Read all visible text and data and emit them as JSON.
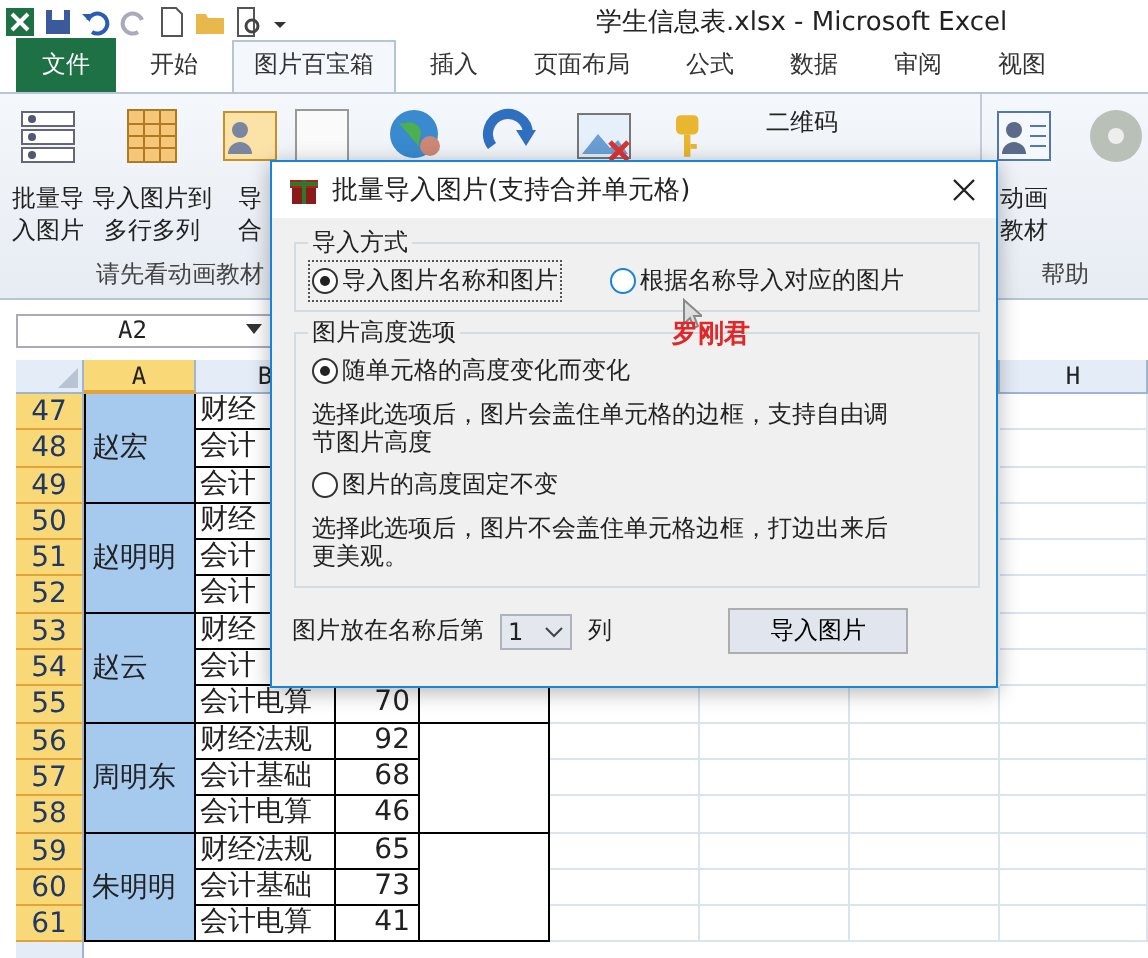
{
  "window": {
    "title": "学生信息表.xlsx  -  Microsoft Excel"
  },
  "ribbon_tabs": [
    {
      "label": "文件",
      "kind": "file",
      "selected": false
    },
    {
      "label": "开始",
      "kind": "tab",
      "selected": false
    },
    {
      "label": "图片百宝箱",
      "kind": "tab",
      "selected": true
    },
    {
      "label": "插入",
      "kind": "tab",
      "selected": false
    },
    {
      "label": "页面布局",
      "kind": "tab",
      "selected": false
    },
    {
      "label": "公式",
      "kind": "tab",
      "selected": false
    },
    {
      "label": "数据",
      "kind": "tab",
      "selected": false
    },
    {
      "label": "审阅",
      "kind": "tab",
      "selected": false
    },
    {
      "label": "视图",
      "kind": "tab",
      "selected": false
    }
  ],
  "ribbon": {
    "buttons": [
      {
        "kind": "list",
        "lines": [
          "批量导",
          "入图片"
        ]
      },
      {
        "kind": "grid",
        "lines": [
          "导入图片到",
          "多行多列"
        ]
      },
      {
        "kind": "card",
        "lines": [
          "导",
          "合"
        ]
      }
    ],
    "group_label": "请先看动画教材",
    "qr_label": "二维码",
    "help_buttons": [
      {
        "lines": [
          "动画",
          "教材"
        ]
      }
    ],
    "help_label": "帮助"
  },
  "name_box": {
    "value": "A2"
  },
  "sheet": {
    "columns": [
      {
        "label": "A",
        "selected": true
      },
      {
        "label": "B",
        "selected": false
      },
      {
        "label": "H",
        "selected": false
      }
    ],
    "groups": [
      {
        "name": "赵宏",
        "selected": true,
        "rows": [
          {
            "num": "47",
            "subject": "财经"
          },
          {
            "num": "48",
            "subject": "会计"
          },
          {
            "num": "49",
            "subject": "会计"
          }
        ]
      },
      {
        "name": "赵明明",
        "selected": true,
        "rows": [
          {
            "num": "50",
            "subject": "财经"
          },
          {
            "num": "51",
            "subject": "会计"
          },
          {
            "num": "52",
            "subject": "会计"
          }
        ]
      },
      {
        "name": "赵云",
        "selected": true,
        "rows": [
          {
            "num": "53",
            "subject": "财经"
          },
          {
            "num": "54",
            "subject": "会计"
          },
          {
            "num": "55",
            "subject": "会计电算",
            "score": "70"
          }
        ]
      },
      {
        "name": "周明东",
        "selected": true,
        "rows": [
          {
            "num": "56",
            "subject": "财经法规",
            "score": "92"
          },
          {
            "num": "57",
            "subject": "会计基础",
            "score": "68"
          },
          {
            "num": "58",
            "subject": "会计电算",
            "score": "46"
          }
        ]
      },
      {
        "name": "朱明明",
        "selected": true,
        "rows": [
          {
            "num": "59",
            "subject": "财经法规",
            "score": "65"
          },
          {
            "num": "60",
            "subject": "会计基础",
            "score": "73"
          },
          {
            "num": "61",
            "subject": "会计电算",
            "score": "41"
          }
        ]
      }
    ]
  },
  "dialog": {
    "title": "批量导入图片(支持合并单元格)",
    "mode_group": {
      "legend": "导入方式",
      "options": [
        {
          "label": "导入图片名称和图片",
          "selected": true
        },
        {
          "label": "根据名称导入对应的图片",
          "selected": false
        }
      ]
    },
    "annotation": "罗刚君",
    "height_group": {
      "legend": "图片高度选项",
      "options": [
        {
          "label": "随单元格的高度变化而变化",
          "selected": true,
          "description": "选择此选项后，图片会盖住单元格的边框，支持自由调节图片高度"
        },
        {
          "label": "图片的高度固定不变",
          "selected": false,
          "description": "选择此选项后，图片不会盖住单元格边框，打边出来后更美观。"
        }
      ]
    },
    "column_label": "图片放在名称后第",
    "column_value": "1",
    "column_suffix": "列",
    "import_button": "导入图片"
  }
}
